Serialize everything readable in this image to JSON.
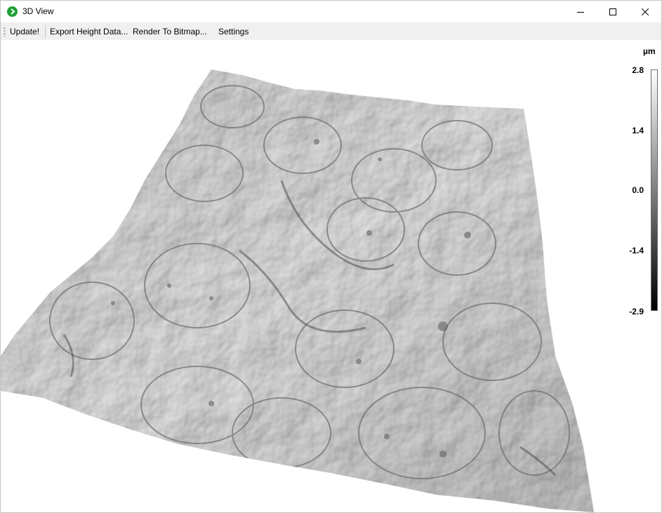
{
  "window": {
    "title": "3D View"
  },
  "menubar": {
    "items": [
      {
        "label": "Update!"
      },
      {
        "label": "Export Height Data..."
      },
      {
        "label": "Render To Bitmap..."
      },
      {
        "label": "Settings"
      }
    ]
  },
  "view3d": {
    "description_icon": "height-map-surface",
    "scale": {
      "unit": "µm",
      "ticks": [
        "2.8",
        "1.4",
        "0.0",
        "-1.4",
        "-2.9"
      ],
      "max": 2.8,
      "min": -2.9
    },
    "colors": {
      "surface_light": "#e6e6e6",
      "surface_mid": "#a8a8a8",
      "surface_dark": "#5a5a5a",
      "app_icon": "#1f9f37"
    }
  }
}
